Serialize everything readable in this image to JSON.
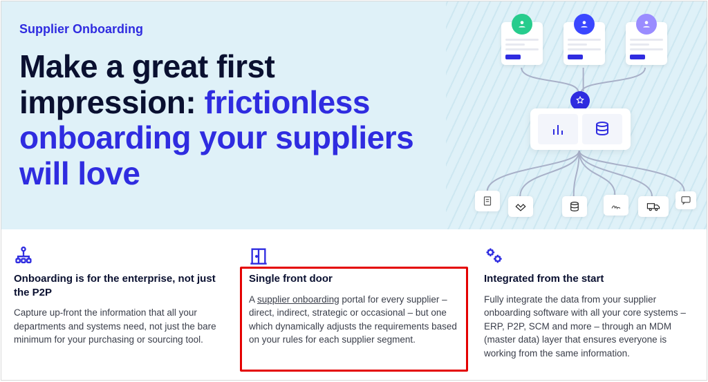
{
  "hero": {
    "eyebrow": "Supplier Onboarding",
    "headline_plain": "Make a great first impression: ",
    "headline_accent": "frictionless onboarding your suppliers will love"
  },
  "features": [
    {
      "icon": "org-tree-icon",
      "title": "Onboarding is for the enterprise, not just the P2P",
      "body_before": "Capture up-front the information that all your departments and systems need, not just the bare minimum for your purchasing or sourcing tool.",
      "body_link": "",
      "body_after": ""
    },
    {
      "icon": "door-icon",
      "title": "Single front door",
      "body_before": "A ",
      "body_link": "supplier onboarding",
      "body_after": " portal for every supplier – direct, indirect, strategic or occasional – but one which dynamically adjusts the requirements based on your rules for each supplier segment."
    },
    {
      "icon": "gears-icon",
      "title": "Integrated from the start",
      "body_before": "Fully integrate the data from your supplier onboarding software with all your core systems – ERP, P2P, SCM and more – through an MDM (master data) layer that ensures everyone is working from the same information.",
      "body_link": "",
      "body_after": ""
    }
  ],
  "colors": {
    "accent": "#2f2ce0",
    "hero_bg": "#dff1f8",
    "highlight_border": "#e40000"
  }
}
